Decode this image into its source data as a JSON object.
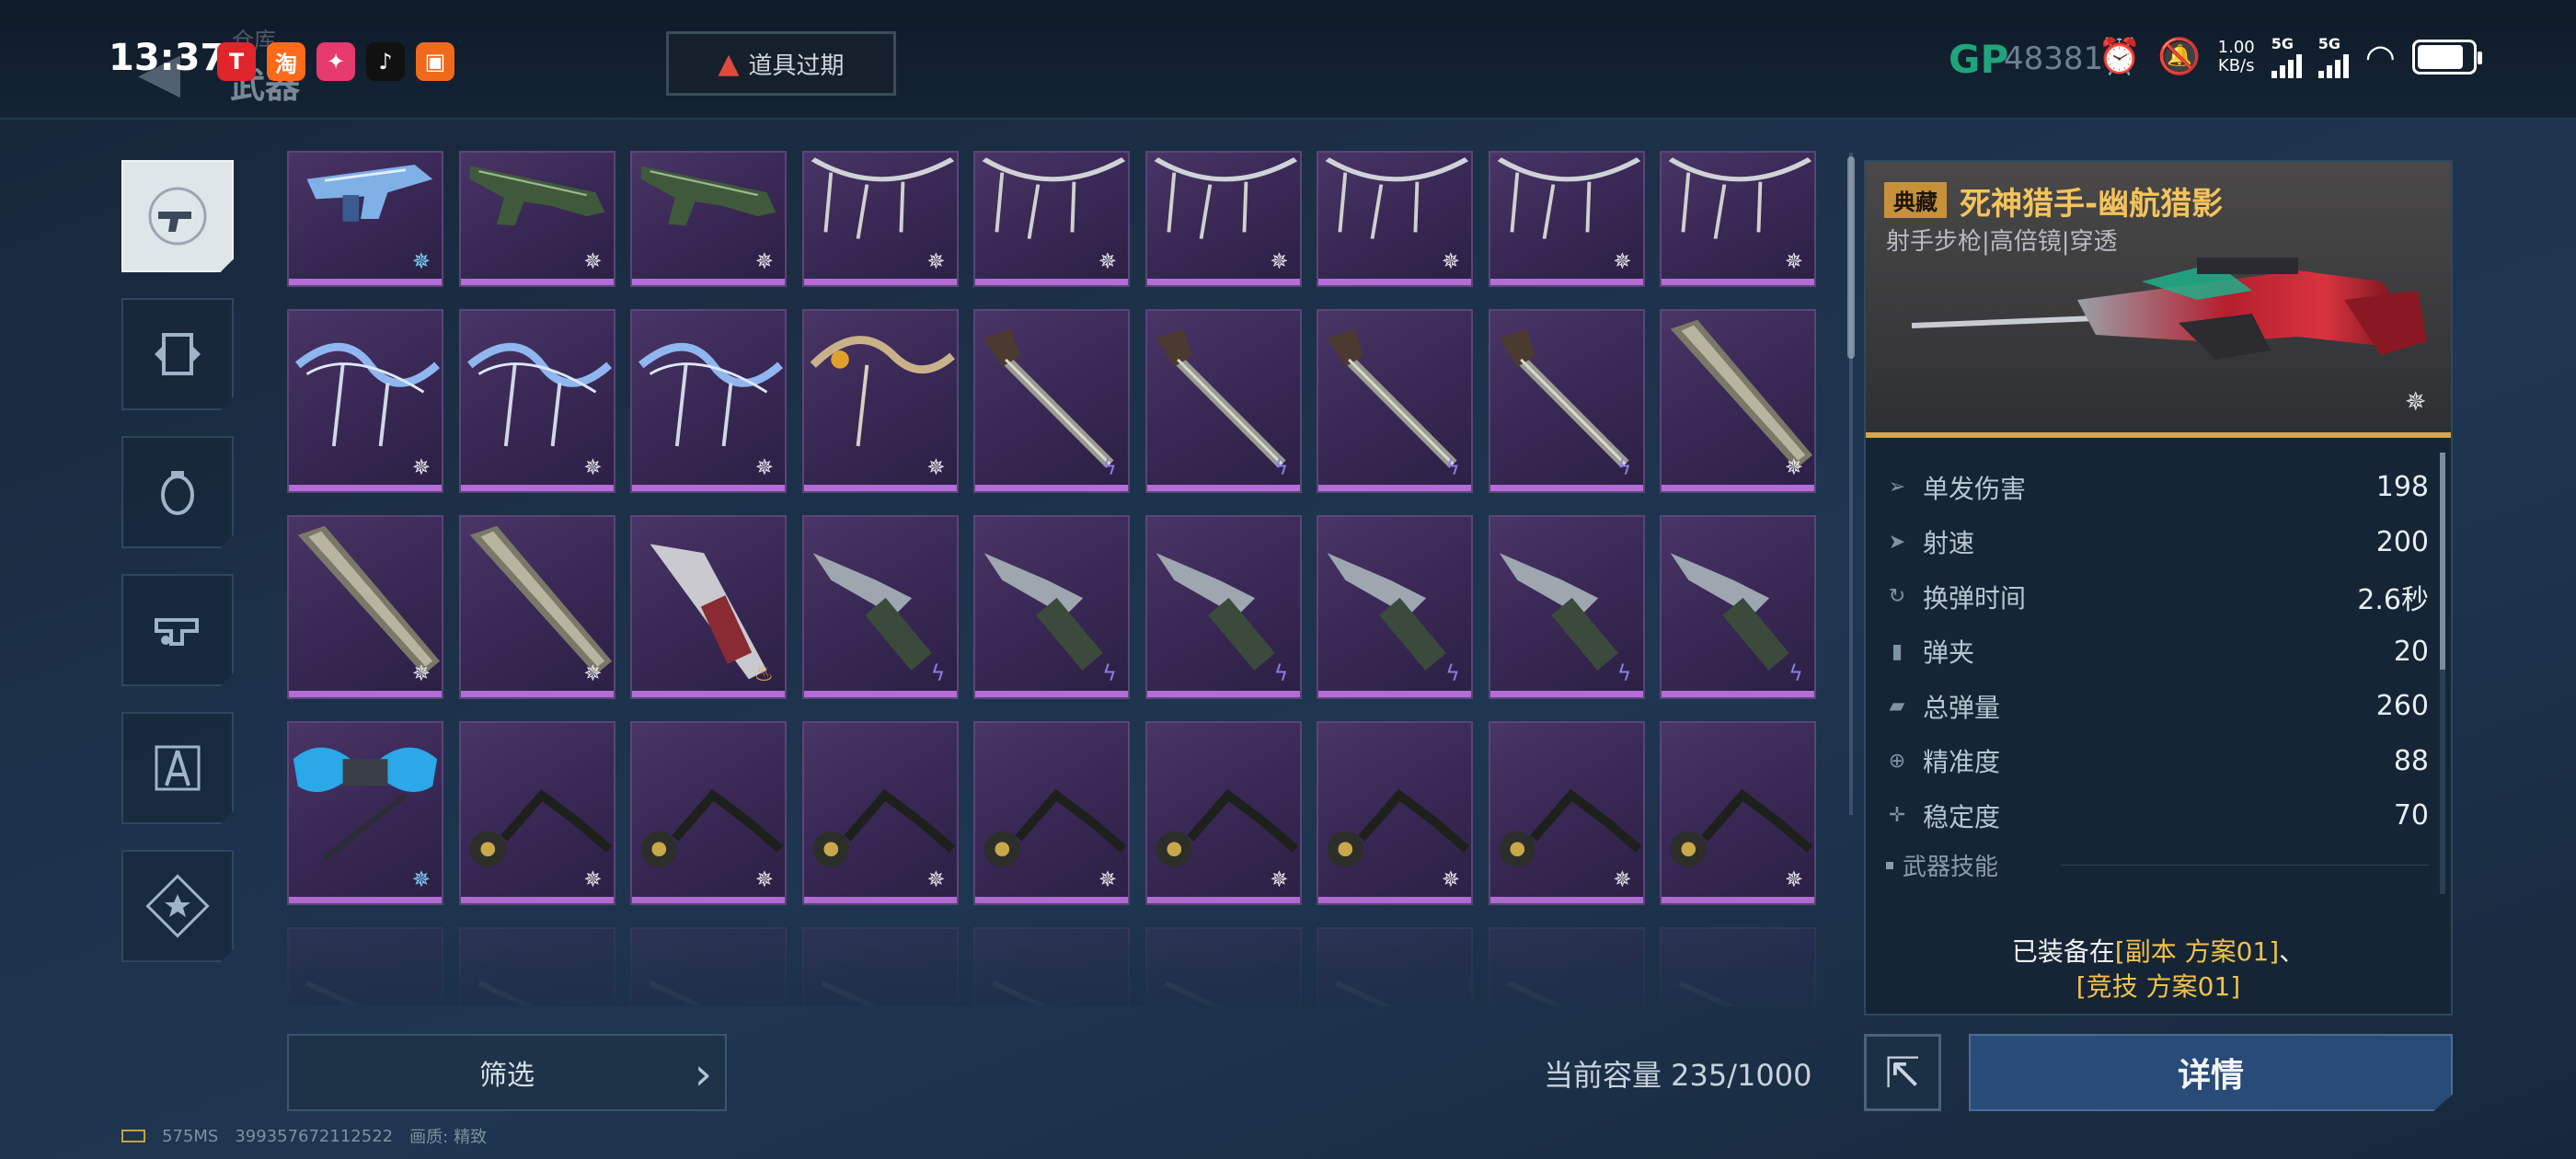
{
  "status_bar": {
    "time": "13:37",
    "apps": [
      {
        "name": "toutiao",
        "glyph": "T",
        "color": "#e0262b"
      },
      {
        "name": "taobao",
        "glyph": "淘",
        "color": "#ff6a1a"
      },
      {
        "name": "game-app",
        "glyph": "✦",
        "color": "#e6396e"
      },
      {
        "name": "tiktok",
        "glyph": "♪",
        "color": "#111111"
      },
      {
        "name": "video-app",
        "glyph": "▣",
        "color": "#f06a1c"
      }
    ],
    "net_speed_value": "1.00",
    "net_speed_unit": "KB/s",
    "sim1": "5G",
    "sim2": "5G",
    "battery_level": 0.85
  },
  "header": {
    "breadcrumb_top": "仓库",
    "breadcrumb_main": "武器",
    "warning_label": "道具过期",
    "currency_label": "GP",
    "currency_value": "48381"
  },
  "sidebar": {
    "categories": [
      {
        "name": "pistol",
        "active": true
      },
      {
        "name": "scroll"
      },
      {
        "name": "grenade"
      },
      {
        "name": "gun-mod"
      },
      {
        "name": "compass-tool"
      },
      {
        "name": "star-badge"
      }
    ]
  },
  "inventory": {
    "rows": [
      [
        "smg-blue:star-blue",
        "rifle-green:star",
        "rifle-green:star",
        "bow-silver:star",
        "bow-silver:star",
        "bow-silver:star",
        "bow-silver:star",
        "bow-silver:star",
        "bow-silver:star"
      ],
      [
        "bow-blue:star",
        "bow-blue:star",
        "bow-blue:star",
        "bow-gold:star",
        "mace-staff:bolt",
        "mace-staff:bolt",
        "mace-staff:bolt",
        "mace-staff:bolt",
        "greatsword:star"
      ],
      [
        "greatsword:star",
        "greatsword:star",
        "knife-red:fire",
        "knife-green:bolt",
        "knife-green:bolt",
        "knife-green:bolt",
        "knife-green:bolt",
        "knife-green:bolt",
        "knife-green:bolt"
      ],
      [
        "wings-blue:star-blue",
        "flail:star",
        "flail:star",
        "flail:star",
        "flail:star",
        "flail:star",
        "flail:star",
        "flail:star",
        "flail:star"
      ],
      [
        "faded:none",
        "faded:none",
        "faded:none",
        "faded:none",
        "faded:none",
        "faded:none",
        "faded:none",
        "faded:none",
        "faded:none"
      ]
    ]
  },
  "footer": {
    "filter_label": "筛选",
    "capacity_label": "当前容量 235/1000",
    "ping": "575MS",
    "uid": "399357672112522",
    "quality_label": "画质:",
    "quality_value": "精致"
  },
  "detail": {
    "rarity": "典藏",
    "name": "死神猎手-幽航猎影",
    "subtitle": "射手步枪|高倍镜|穿透",
    "stats": [
      {
        "icon": "damage-icon",
        "glyph": "➢",
        "label": "单发伤害",
        "value": "198"
      },
      {
        "icon": "firerate-icon",
        "glyph": "➤",
        "label": "射速",
        "value": "200"
      },
      {
        "icon": "reload-icon",
        "glyph": "↻",
        "label": "换弹时间",
        "value": "2.6秒"
      },
      {
        "icon": "magazine-icon",
        "glyph": "▮",
        "label": "弹夹",
        "value": "20"
      },
      {
        "icon": "ammo-icon",
        "glyph": "▰",
        "label": "总弹量",
        "value": "260"
      },
      {
        "icon": "accuracy-icon",
        "glyph": "⊕",
        "label": "精准度",
        "value": "88"
      },
      {
        "icon": "stability-icon",
        "glyph": "✛",
        "label": "稳定度",
        "value": "70"
      }
    ],
    "skill_header": "武器技能",
    "equipped_prefix": "已装备在",
    "equipped_slot1": "[副本 方案01]",
    "equipped_sep": "、",
    "equipped_slot2": "[竞技 方案01]",
    "detail_button": "详情"
  }
}
